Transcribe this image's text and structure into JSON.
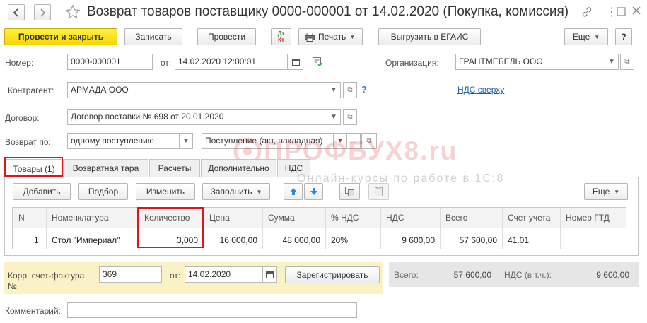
{
  "header": {
    "title": "Возврат товаров поставщику 0000-000001 от 14.02.2020 (Покупка, комиссия)"
  },
  "toolbar": {
    "post_close": "Провести и закрыть",
    "save": "Записать",
    "post": "Провести",
    "dtkt_top": "Дт",
    "dtkt_bottom": "Кт",
    "print": "Печать",
    "egais": "Выгрузить в ЕГАИС",
    "more": "Еще",
    "help": "?"
  },
  "form": {
    "number_label": "Номер:",
    "number_value": "0000-000001",
    "date_label": "от:",
    "date_value": "14.02.2020 12:00:01",
    "org_label": "Организация:",
    "org_value": "ГРАНТМЕБЕЛЬ ООО",
    "contractor_label": "Контрагент:",
    "contractor_value": "АРМАДА ООО",
    "contractor_help": "?",
    "vat_top_link": "НДС сверху",
    "contract_label": "Договор:",
    "contract_value": "Договор поставки № 698 от 20.01.2020",
    "return_label": "Возврат по:",
    "return_value": "одному поступлению",
    "receipt_value": "Поступление (акт, накладная)"
  },
  "tabs": [
    {
      "label": "Товары (1)"
    },
    {
      "label": "Возвратная тара"
    },
    {
      "label": "Расчеты"
    },
    {
      "label": "Дополнительно"
    },
    {
      "label": "НДС"
    }
  ],
  "table_toolbar": {
    "add": "Добавить",
    "pick": "Подбор",
    "edit": "Изменить",
    "fill": "Заполнить",
    "more": "Еще"
  },
  "table": {
    "columns": [
      "N",
      "Номенклатура",
      "Количество",
      "Цена",
      "Сумма",
      "% НДС",
      "НДС",
      "Всего",
      "Счет учета",
      "Номер ГТД"
    ],
    "rows": [
      [
        "1",
        "Стол \"Империал\"",
        "3,000",
        "16 000,00",
        "48 000,00",
        "20%",
        "9 600,00",
        "57 600,00",
        "41.01",
        ""
      ]
    ]
  },
  "footer": {
    "invoice_label_1": "Корр. счет-фактура",
    "invoice_label_2": "№",
    "invoice_number": "369",
    "invoice_date_label": "от:",
    "invoice_date": "14.02.2020",
    "register": "Зарегистрировать",
    "total_label": "Всего:",
    "total_value": "57 600,00",
    "vat_label": "НДС (в т.ч.):",
    "vat_value": "9 600,00",
    "comment_label": "Комментарий:",
    "comment_value": ""
  },
  "watermark": {
    "brand": "ПРОФБУХ8.ru",
    "tagline": "Онлайн-курсы по работе в 1С:8"
  },
  "colors": {
    "accent_yellow": "#f7d600",
    "highlight_red": "#e0141b",
    "link_blue": "#1f5fa8",
    "footer_yellow": "#fbf1c6",
    "footer_gray": "#e6e6e6"
  }
}
